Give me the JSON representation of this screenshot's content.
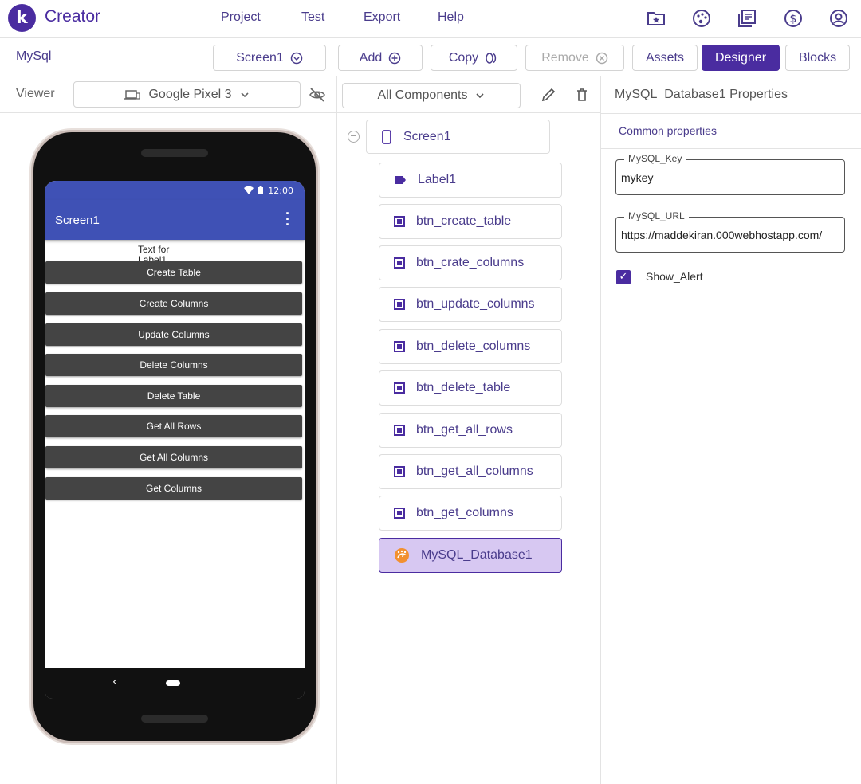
{
  "brand": {
    "logo_letter": "k",
    "name": "Creator",
    "color": "#4a2ca0"
  },
  "menu": [
    {
      "label": "Project"
    },
    {
      "label": "Test"
    },
    {
      "label": "Export"
    },
    {
      "label": "Help"
    }
  ],
  "top_icons": [
    "folder-star-icon",
    "palette-icon",
    "library-icon",
    "dollar-icon",
    "account-icon"
  ],
  "toolbar": {
    "project_name": "MySql",
    "screen_label": "Screen1",
    "add_label": "Add",
    "copy_label": "Copy",
    "remove_label": "Remove",
    "assets_label": "Assets",
    "designer_label": "Designer",
    "blocks_label": "Blocks"
  },
  "viewer": {
    "label": "Viewer",
    "device": "Google Pixel 3"
  },
  "phone": {
    "time": "12:00",
    "screen_title": "Screen1",
    "label_text": "Text for Label1",
    "buttons": [
      {
        "label": "Create Table"
      },
      {
        "label": "Create Columns"
      },
      {
        "label": "Update Columns"
      },
      {
        "label": "Delete Columns"
      },
      {
        "label": "Delete Table"
      },
      {
        "label": "Get All Rows"
      },
      {
        "label": "Get All Columns"
      },
      {
        "label": "Get Columns"
      }
    ]
  },
  "components": {
    "filter": "All Components",
    "root": "Screen1",
    "items": [
      {
        "name": "Label1",
        "type": "label"
      },
      {
        "name": "btn_create_table",
        "type": "button"
      },
      {
        "name": "btn_crate_columns",
        "type": "button"
      },
      {
        "name": "btn_update_columns",
        "type": "button"
      },
      {
        "name": "btn_delete_columns",
        "type": "button"
      },
      {
        "name": "btn_delete_table",
        "type": "button"
      },
      {
        "name": "btn_get_all_rows",
        "type": "button"
      },
      {
        "name": "btn_get_all_columns",
        "type": "button"
      },
      {
        "name": "btn_get_columns",
        "type": "button"
      },
      {
        "name": "MySQL_Database1",
        "type": "extension",
        "selected": true
      }
    ]
  },
  "properties": {
    "title": "MySQL_Database1 Properties",
    "section": "Common properties",
    "key_label": "MySQL_Key",
    "key_value": "mykey",
    "url_label": "MySQL_URL",
    "url_value": "https://maddekiran.000webhostapp.com/",
    "alert_label": "Show_Alert",
    "alert_checked": true
  }
}
